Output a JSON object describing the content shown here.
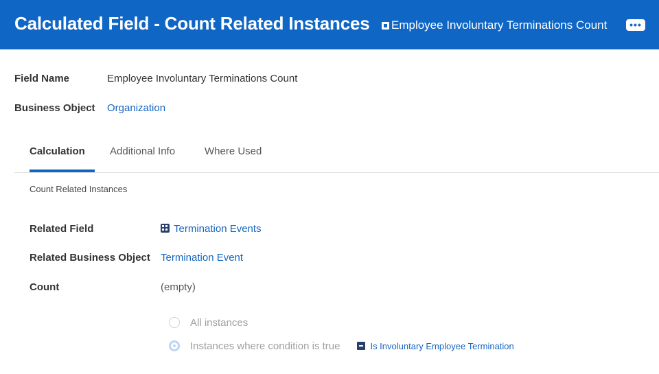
{
  "header": {
    "title": "Calculated Field - Count Related Instances",
    "instance_name": "Employee Involuntary Terminations Count",
    "more_label": "•••",
    "background_color": "#0f66c5"
  },
  "fields": {
    "field_name_label": "Field Name",
    "field_name_value": "Employee Involuntary Terminations Count",
    "business_object_label": "Business Object",
    "business_object_value": "Organization"
  },
  "tabs": [
    {
      "label": "Calculation",
      "active": true
    },
    {
      "label": "Additional Info",
      "active": false
    },
    {
      "label": "Where Used",
      "active": false
    }
  ],
  "calculation": {
    "section_title": "Count Related Instances",
    "related_field_label": "Related Field",
    "related_field_value": "Termination Events",
    "related_bo_label": "Related Business Object",
    "related_bo_value": "Termination Event",
    "count_label": "Count",
    "count_value": "(empty)",
    "options": [
      {
        "label": "All instances",
        "selected": false
      },
      {
        "label": "Instances where condition is true",
        "selected": true
      }
    ],
    "condition_link": "Is Involuntary Employee Termination"
  },
  "colors": {
    "accent": "#0f66c5",
    "link": "#1565c0"
  }
}
